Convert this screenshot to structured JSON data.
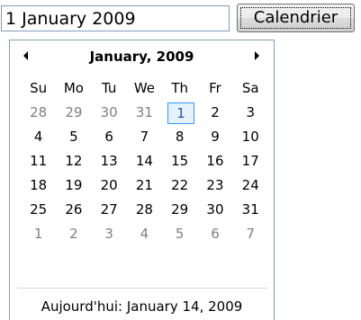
{
  "date_input": {
    "value": "1 January 2009"
  },
  "calendar_button": {
    "label": "Calendrier"
  },
  "calendar": {
    "month_title": "January, 2009",
    "weekdays": [
      "Su",
      "Mo",
      "Tu",
      "We",
      "Th",
      "Fr",
      "Sa"
    ],
    "weeks": [
      [
        {
          "d": "28",
          "other": true
        },
        {
          "d": "29",
          "other": true
        },
        {
          "d": "30",
          "other": true
        },
        {
          "d": "31",
          "other": true
        },
        {
          "d": "1",
          "selected": true
        },
        {
          "d": "2"
        },
        {
          "d": "3"
        }
      ],
      [
        {
          "d": "4"
        },
        {
          "d": "5"
        },
        {
          "d": "6"
        },
        {
          "d": "7"
        },
        {
          "d": "8"
        },
        {
          "d": "9"
        },
        {
          "d": "10"
        }
      ],
      [
        {
          "d": "11"
        },
        {
          "d": "12"
        },
        {
          "d": "13"
        },
        {
          "d": "14"
        },
        {
          "d": "15"
        },
        {
          "d": "16"
        },
        {
          "d": "17"
        }
      ],
      [
        {
          "d": "18"
        },
        {
          "d": "19"
        },
        {
          "d": "20"
        },
        {
          "d": "21"
        },
        {
          "d": "22"
        },
        {
          "d": "23"
        },
        {
          "d": "24"
        }
      ],
      [
        {
          "d": "25"
        },
        {
          "d": "26"
        },
        {
          "d": "27"
        },
        {
          "d": "28"
        },
        {
          "d": "29"
        },
        {
          "d": "30"
        },
        {
          "d": "31"
        }
      ],
      [
        {
          "d": "1",
          "other": true
        },
        {
          "d": "2",
          "other": true
        },
        {
          "d": "3",
          "other": true
        },
        {
          "d": "4",
          "other": true
        },
        {
          "d": "5",
          "other": true
        },
        {
          "d": "6",
          "other": true
        },
        {
          "d": "7",
          "other": true
        }
      ]
    ],
    "today_label": "Aujourd'hui: January 14, 2009",
    "prev_icon": "triangle-left",
    "next_icon": "triangle-right",
    "selected_color": "#3399ff",
    "other_month_color": "#808080"
  }
}
